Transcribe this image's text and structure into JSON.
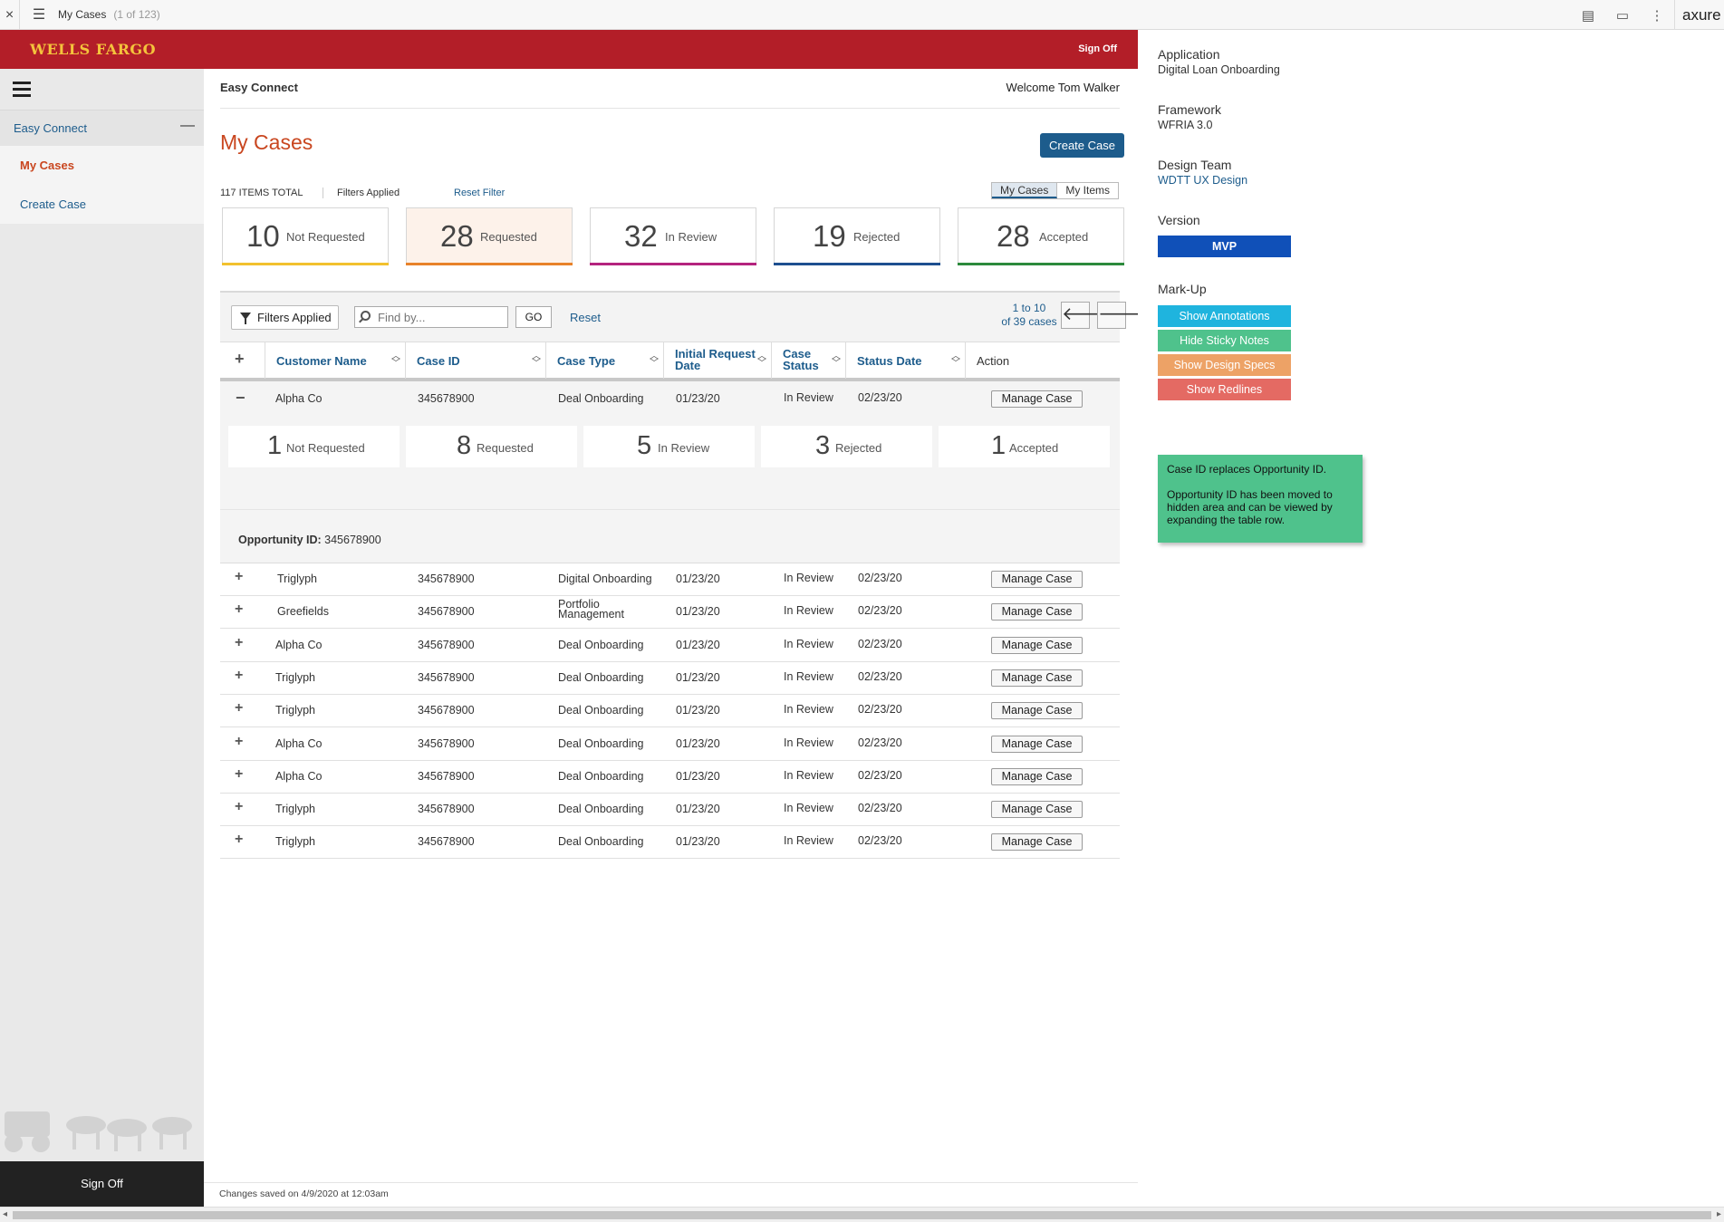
{
  "axure": {
    "page_name": "My Cases",
    "page_count": "(1 of 123)",
    "brand": "axure"
  },
  "header": {
    "brand": "WELLS FARGO",
    "sign_off": "Sign Off"
  },
  "sidebar": {
    "section": "Easy Connect",
    "items": [
      {
        "label": "My Cases"
      },
      {
        "label": "Create Case"
      }
    ],
    "sign_off": "Sign Off"
  },
  "main": {
    "app_name": "Easy Connect",
    "welcome": "Welcome Tom Walker",
    "title": "My Cases",
    "create_case": "Create Case",
    "items_total": "117 ITEMS TOTAL",
    "filters_applied": "Filters Applied",
    "reset_filter": "Reset Filter",
    "toggle": [
      "My Cases",
      "My Items"
    ]
  },
  "stats": [
    {
      "num": "10",
      "label": "Not Requested",
      "color": "#f2c12e",
      "bg": "#ffffff"
    },
    {
      "num": "28",
      "label": "Requested",
      "color": "#e8822a",
      "bg": "#fdf2ea"
    },
    {
      "num": "32",
      "label": "In Review",
      "color": "#b4237e",
      "bg": "#ffffff"
    },
    {
      "num": "19",
      "label": "Rejected",
      "color": "#1d4f8f",
      "bg": "#ffffff"
    },
    {
      "num": "28",
      "label": "Accepted",
      "color": "#2c8a3c",
      "bg": "#ffffff"
    }
  ],
  "toolbar": {
    "filters": "Filters Applied",
    "search_placeholder": "Find by...",
    "go": "GO",
    "reset": "Reset",
    "paging_line1": "1 to 10",
    "paging_line2": "of 39 cases"
  },
  "columns": [
    "Customer Name",
    "Case ID",
    "Case Type",
    "Initial Request Date",
    "Case Status",
    "Status Date",
    "Action"
  ],
  "expanded": {
    "customer": "Alpha Co",
    "case_id": "345678900",
    "case_type": "Deal Onboarding",
    "initial_date": "01/23/20",
    "status": "In Review",
    "status_date": "02/23/20",
    "action": "Manage Case",
    "mini_stats": [
      {
        "num": "1",
        "label": "Not Requested"
      },
      {
        "num": "8",
        "label": "Requested"
      },
      {
        "num": "5",
        "label": "In Review"
      },
      {
        "num": "3",
        "label": "Rejected"
      },
      {
        "num": "1",
        "label": "Accepted"
      }
    ],
    "opp_label": "Opportunity ID:",
    "opp_value": "345678900"
  },
  "rows": [
    {
      "customer": "Triglyph",
      "case_id": "345678900",
      "case_type": "Digital Onboarding",
      "initial_date": "01/23/20",
      "status": "In Review",
      "status_date": "02/23/20",
      "action": "Manage Case"
    },
    {
      "customer": "Greefields",
      "case_id": "345678900",
      "case_type": "Portfolio Management",
      "initial_date": "01/23/20",
      "status": "In Review",
      "status_date": "02/23/20",
      "action": "Manage Case"
    },
    {
      "customer": "Alpha Co",
      "case_id": "345678900",
      "case_type": "Deal Onboarding",
      "initial_date": "01/23/20",
      "status": "In Review",
      "status_date": "02/23/20",
      "action": "Manage Case"
    },
    {
      "customer": "Triglyph",
      "case_id": "345678900",
      "case_type": "Deal Onboarding",
      "initial_date": "01/23/20",
      "status": "In Review",
      "status_date": "02/23/20",
      "action": "Manage Case"
    },
    {
      "customer": "Triglyph",
      "case_id": "345678900",
      "case_type": "Deal Onboarding",
      "initial_date": "01/23/20",
      "status": "In Review",
      "status_date": "02/23/20",
      "action": "Manage Case"
    },
    {
      "customer": "Alpha Co",
      "case_id": "345678900",
      "case_type": "Deal Onboarding",
      "initial_date": "01/23/20",
      "status": "In Review",
      "status_date": "02/23/20",
      "action": "Manage Case"
    },
    {
      "customer": "Alpha Co",
      "case_id": "345678900",
      "case_type": "Deal Onboarding",
      "initial_date": "01/23/20",
      "status": "In Review",
      "status_date": "02/23/20",
      "action": "Manage Case"
    },
    {
      "customer": "Triglyph",
      "case_id": "345678900",
      "case_type": "Deal Onboarding",
      "initial_date": "01/23/20",
      "status": "In Review",
      "status_date": "02/23/20",
      "action": "Manage Case"
    },
    {
      "customer": "Triglyph",
      "case_id": "345678900",
      "case_type": "Deal Onboarding",
      "initial_date": "01/23/20",
      "status": "In Review",
      "status_date": "02/23/20",
      "action": "Manage Case"
    }
  ],
  "footer": "Changes saved on 4/9/2020 at 12:03am",
  "panel": {
    "application_label": "Application",
    "application_value": "Digital Loan Onboarding",
    "framework_label": "Framework",
    "framework_value": "WFRIA 3.0",
    "team_label": "Design Team",
    "team_value": "WDTT UX Design",
    "version_label": "Version",
    "version_value": "MVP",
    "markup_label": "Mark-Up",
    "buttons": [
      {
        "label": "Show Annotations",
        "color": "#1fb4de"
      },
      {
        "label": "Hide Sticky Notes",
        "color": "#4fc28c"
      },
      {
        "label": "Show Design Specs",
        "color": "#eda266"
      },
      {
        "label": "Show Redlines",
        "color": "#e46a63"
      }
    ],
    "sticky_line1": "Case ID replaces Opportunity ID.",
    "sticky_line2": "Opportunity ID has been moved to hidden area and can be viewed by expanding the table row."
  }
}
